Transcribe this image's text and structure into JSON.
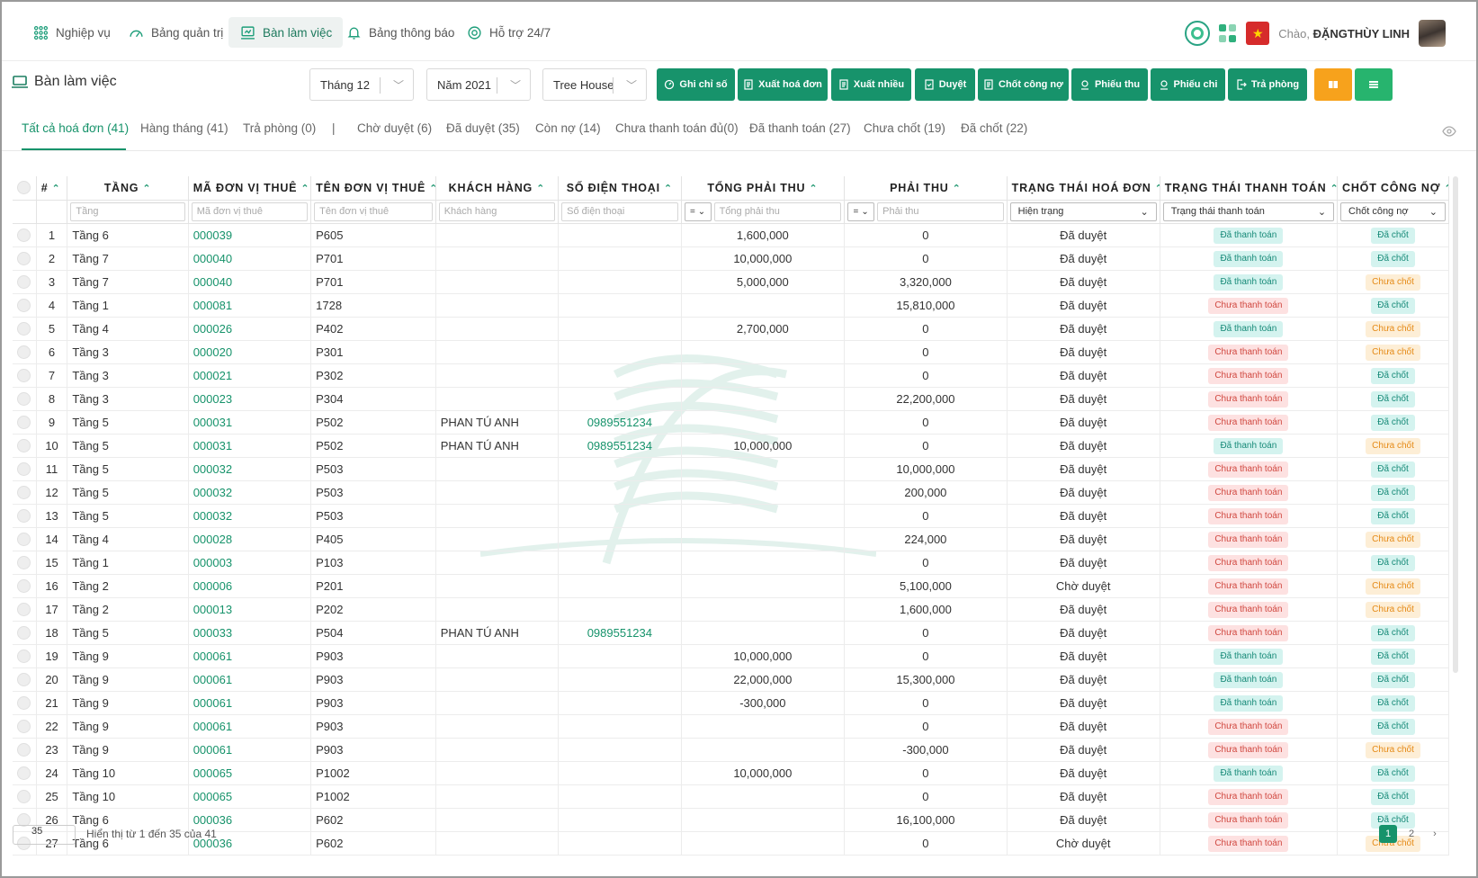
{
  "nav": {
    "items": [
      {
        "label": "Nghiệp vụ"
      },
      {
        "label": "Bảng quản trị"
      },
      {
        "label": "Bàn làm việc"
      },
      {
        "label": "Bảng thông báo"
      },
      {
        "label": "Hỗ trợ 24/7"
      }
    ],
    "greeting_prefix": "Chào,",
    "user_name": "ĐẶNGTHÙY LINH",
    "flag_star": "★"
  },
  "header": {
    "title": "Bàn làm việc",
    "month": "Tháng 12",
    "year": "Năm 2021",
    "building": "Tree House",
    "buttons": {
      "ghi_chi_so": "Ghi chỉ số",
      "xuat_hoa_don": "Xuất hoá đơn",
      "xuat_nhieu": "Xuất nhiều",
      "duyet": "Duyệt",
      "chot_cong_no": "Chốt công nợ",
      "phieu_thu": "Phiếu thu",
      "phieu_chi": "Phiếu chi",
      "tra_phong": "Trả phòng"
    }
  },
  "tabs": {
    "all": "Tất cả hoá đơn (41)",
    "monthly": "Hàng tháng (41)",
    "checkout": "Trả phòng (0)",
    "separator": "|",
    "pending": "Chờ duyệt (6)",
    "approved": "Đã duyệt (35)",
    "debt": "Còn nợ (14)",
    "partial": "Chưa thanh toán đủ(0)",
    "paid": "Đã thanh toán (27)",
    "unlocked": "Chưa chốt (19)",
    "locked": "Đã chốt (22)"
  },
  "table": {
    "headers": {
      "index": "#",
      "floor": "TẦNG",
      "unit_code": "MÃ ĐƠN VỊ THUÊ",
      "unit_name": "TÊN ĐƠN VỊ THUÊ",
      "customer": "KHÁCH HÀNG",
      "phone": "SỐ ĐIỆN THOẠI",
      "total": "TỔNG PHẢI THU",
      "due": "PHẢI THU",
      "invoice_status": "TRẠNG THÁI HOÁ ĐƠN",
      "payment_status": "TRẠNG THÁI THANH TOÁN",
      "debt_lock": "CHỐT CÔNG NỢ"
    },
    "filters": {
      "floor": "Tầng",
      "unit_code": "Mã đơn vị thuê",
      "unit_name": "Tên đơn vị thuê",
      "customer": "Khách hàng",
      "phone": "Số điện thoại",
      "total": "Tổng phải thu",
      "due": "Phải thu",
      "op": "=",
      "invoice_status": "Hiện trạng",
      "payment_status": "Trạng thái thanh toán",
      "debt_lock": "Chốt công nợ"
    },
    "rows": [
      {
        "i": "1",
        "floor": "Tầng 6",
        "code": "000039",
        "name": "P605",
        "customer": "",
        "phone": "",
        "total": "1,600,000",
        "due": "0",
        "inv": "Đã duyệt",
        "pay": "Đã thanh toán",
        "lock": "Đã chốt"
      },
      {
        "i": "2",
        "floor": "Tầng 7",
        "code": "000040",
        "name": "P701",
        "customer": "",
        "phone": "",
        "total": "10,000,000",
        "due": "0",
        "inv": "Đã duyệt",
        "pay": "Đã thanh toán",
        "lock": "Đã chốt"
      },
      {
        "i": "3",
        "floor": "Tầng 7",
        "code": "000040",
        "name": "P701",
        "customer": "",
        "phone": "",
        "total": "5,000,000",
        "due": "3,320,000",
        "inv": "Đã duyệt",
        "pay": "Đã thanh toán",
        "lock": "Chưa chốt"
      },
      {
        "i": "4",
        "floor": "Tầng 1",
        "code": "000081",
        "name": "1728",
        "customer": "",
        "phone": "",
        "total": "",
        "due": "15,810,000",
        "inv": "Đã duyệt",
        "pay": "Chưa thanh toán",
        "lock": "Đã chốt"
      },
      {
        "i": "5",
        "floor": "Tầng 4",
        "code": "000026",
        "name": "P402",
        "customer": "",
        "phone": "",
        "total": "2,700,000",
        "due": "0",
        "inv": "Đã duyệt",
        "pay": "Đã thanh toán",
        "lock": "Chưa chốt"
      },
      {
        "i": "6",
        "floor": "Tầng 3",
        "code": "000020",
        "name": "P301",
        "customer": "",
        "phone": "",
        "total": "",
        "due": "0",
        "inv": "Đã duyệt",
        "pay": "Chưa thanh toán",
        "lock": "Chưa chốt"
      },
      {
        "i": "7",
        "floor": "Tầng 3",
        "code": "000021",
        "name": "P302",
        "customer": "",
        "phone": "",
        "total": "",
        "due": "0",
        "inv": "Đã duyệt",
        "pay": "Chưa thanh toán",
        "lock": "Đã chốt"
      },
      {
        "i": "8",
        "floor": "Tầng 3",
        "code": "000023",
        "name": "P304",
        "customer": "",
        "phone": "",
        "total": "",
        "due": "22,200,000",
        "inv": "Đã duyệt",
        "pay": "Chưa thanh toán",
        "lock": "Đã chốt"
      },
      {
        "i": "9",
        "floor": "Tầng 5",
        "code": "000031",
        "name": "P502",
        "customer": "PHAN TÚ ANH",
        "phone": "0989551234",
        "total": "",
        "due": "0",
        "inv": "Đã duyệt",
        "pay": "Chưa thanh toán",
        "lock": "Đã chốt"
      },
      {
        "i": "10",
        "floor": "Tầng 5",
        "code": "000031",
        "name": "P502",
        "customer": "PHAN TÚ ANH",
        "phone": "0989551234",
        "total": "10,000,000",
        "due": "0",
        "inv": "Đã duyệt",
        "pay": "Đã thanh toán",
        "lock": "Chưa chốt"
      },
      {
        "i": "11",
        "floor": "Tầng 5",
        "code": "000032",
        "name": "P503",
        "customer": "",
        "phone": "",
        "total": "",
        "due": "10,000,000",
        "inv": "Đã duyệt",
        "pay": "Chưa thanh toán",
        "lock": "Đã chốt"
      },
      {
        "i": "12",
        "floor": "Tầng 5",
        "code": "000032",
        "name": "P503",
        "customer": "",
        "phone": "",
        "total": "",
        "due": "200,000",
        "inv": "Đã duyệt",
        "pay": "Chưa thanh toán",
        "lock": "Đã chốt"
      },
      {
        "i": "13",
        "floor": "Tầng 5",
        "code": "000032",
        "name": "P503",
        "customer": "",
        "phone": "",
        "total": "",
        "due": "0",
        "inv": "Đã duyệt",
        "pay": "Chưa thanh toán",
        "lock": "Đã chốt"
      },
      {
        "i": "14",
        "floor": "Tầng 4",
        "code": "000028",
        "name": "P405",
        "customer": "",
        "phone": "",
        "total": "",
        "due": "224,000",
        "inv": "Đã duyệt",
        "pay": "Chưa thanh toán",
        "lock": "Chưa chốt"
      },
      {
        "i": "15",
        "floor": "Tầng 1",
        "code": "000003",
        "name": "P103",
        "customer": "",
        "phone": "",
        "total": "",
        "due": "0",
        "inv": "Đã duyệt",
        "pay": "Chưa thanh toán",
        "lock": "Đã chốt"
      },
      {
        "i": "16",
        "floor": "Tầng 2",
        "code": "000006",
        "name": "P201",
        "customer": "",
        "phone": "",
        "total": "",
        "due": "5,100,000",
        "inv": "Chờ duyệt",
        "pay": "Chưa thanh toán",
        "lock": "Chưa chốt"
      },
      {
        "i": "17",
        "floor": "Tầng 2",
        "code": "000013",
        "name": "P202",
        "customer": "",
        "phone": "",
        "total": "",
        "due": "1,600,000",
        "inv": "Đã duyệt",
        "pay": "Chưa thanh toán",
        "lock": "Chưa chốt"
      },
      {
        "i": "18",
        "floor": "Tầng 5",
        "code": "000033",
        "name": "P504",
        "customer": "PHAN TÚ ANH",
        "phone": "0989551234",
        "total": "",
        "due": "0",
        "inv": "Đã duyệt",
        "pay": "Chưa thanh toán",
        "lock": "Đã chốt"
      },
      {
        "i": "19",
        "floor": "Tầng 9",
        "code": "000061",
        "name": "P903",
        "customer": "",
        "phone": "",
        "total": "10,000,000",
        "due": "0",
        "inv": "Đã duyệt",
        "pay": "Đã thanh toán",
        "lock": "Đã chốt"
      },
      {
        "i": "20",
        "floor": "Tầng 9",
        "code": "000061",
        "name": "P903",
        "customer": "",
        "phone": "",
        "total": "22,000,000",
        "due": "15,300,000",
        "inv": "Đã duyệt",
        "pay": "Đã thanh toán",
        "lock": "Đã chốt"
      },
      {
        "i": "21",
        "floor": "Tầng 9",
        "code": "000061",
        "name": "P903",
        "customer": "",
        "phone": "",
        "total": "-300,000",
        "due": "0",
        "inv": "Đã duyệt",
        "pay": "Đã thanh toán",
        "lock": "Đã chốt"
      },
      {
        "i": "22",
        "floor": "Tầng 9",
        "code": "000061",
        "name": "P903",
        "customer": "",
        "phone": "",
        "total": "",
        "due": "0",
        "inv": "Đã duyệt",
        "pay": "Chưa thanh toán",
        "lock": "Đã chốt"
      },
      {
        "i": "23",
        "floor": "Tầng 9",
        "code": "000061",
        "name": "P903",
        "customer": "",
        "phone": "",
        "total": "",
        "due": "-300,000",
        "inv": "Đã duyệt",
        "pay": "Chưa thanh toán",
        "lock": "Chưa chốt"
      },
      {
        "i": "24",
        "floor": "Tầng 10",
        "code": "000065",
        "name": "P1002",
        "customer": "",
        "phone": "",
        "total": "10,000,000",
        "due": "0",
        "inv": "Đã duyệt",
        "pay": "Đã thanh toán",
        "lock": "Đã chốt"
      },
      {
        "i": "25",
        "floor": "Tầng 10",
        "code": "000065",
        "name": "P1002",
        "customer": "",
        "phone": "",
        "total": "",
        "due": "0",
        "inv": "Đã duyệt",
        "pay": "Chưa thanh toán",
        "lock": "Đã chốt"
      },
      {
        "i": "26",
        "floor": "Tầng 6",
        "code": "000036",
        "name": "P602",
        "customer": "",
        "phone": "",
        "total": "",
        "due": "16,100,000",
        "inv": "Đã duyệt",
        "pay": "Chưa thanh toán",
        "lock": "Đã chốt"
      },
      {
        "i": "27",
        "floor": "Tầng 6",
        "code": "000036",
        "name": "P602",
        "customer": "",
        "phone": "",
        "total": "",
        "due": "0",
        "inv": "Chờ duyệt",
        "pay": "Chưa thanh toán",
        "lock": "Chưa chốt"
      }
    ]
  },
  "footer": {
    "page_size": "35",
    "info": "Hiển thị từ 1 đến 35 của 41",
    "pages": [
      "1",
      "2"
    ],
    "next": "›"
  },
  "colors": {
    "accent": "#17936b",
    "paid_bg": "#d4f3ef",
    "unpaid_bg": "#fde1e1",
    "unlocked_bg": "#fdeed6"
  }
}
